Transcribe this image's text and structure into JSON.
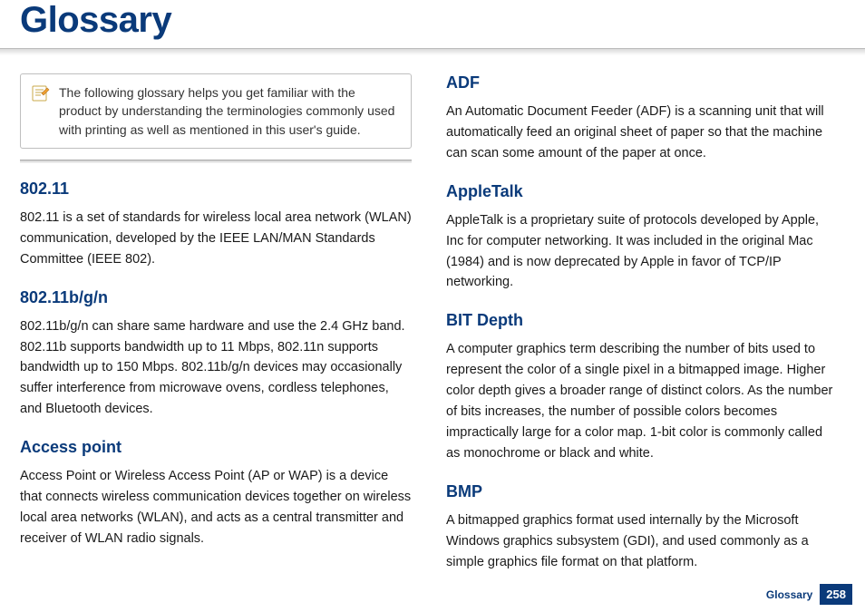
{
  "header": {
    "title": "Glossary"
  },
  "note": {
    "icon": "note-icon",
    "text": "The following glossary helps you get familiar with the product by understanding the terminologies commonly used with printing as well as mentioned in this user's guide."
  },
  "left": [
    {
      "term": "802.11",
      "definition": "802.11 is a set of standards for wireless local area network (WLAN) communication, developed by the IEEE LAN/MAN Standards Committee (IEEE 802)."
    },
    {
      "term": "802.11b/g/n",
      "definition": "802.11b/g/n can share same hardware and use the 2.4 GHz band. 802.11b supports bandwidth up to 11 Mbps, 802.11n supports bandwidth up to 150 Mbps. 802.11b/g/n devices may occasionally suffer interference from microwave ovens, cordless telephones, and Bluetooth devices."
    },
    {
      "term": "Access point",
      "definition": "Access Point or Wireless Access Point (AP or WAP) is a device that connects wireless communication devices together on wireless local area networks (WLAN), and acts as a central transmitter and receiver of WLAN radio signals."
    }
  ],
  "right": [
    {
      "term": "ADF",
      "definition": "An Automatic Document Feeder (ADF) is a scanning unit that will automatically feed an original sheet of paper so that the machine can scan some amount of the paper at once."
    },
    {
      "term": "AppleTalk",
      "definition": "AppleTalk is a proprietary suite of protocols developed by Apple, Inc for computer networking. It was included in the original Mac (1984) and is now deprecated by Apple in favor of TCP/IP networking."
    },
    {
      "term": "BIT Depth",
      "definition": "A computer graphics term describing the number of bits used to represent the color of a single pixel in a bitmapped image. Higher color depth gives a broader range of distinct colors. As the number of bits increases, the number of possible colors becomes impractically large for a color map. 1-bit color is commonly called as monochrome or black and white."
    },
    {
      "term": "BMP",
      "definition": "A bitmapped graphics format used internally by the Microsoft Windows graphics subsystem (GDI), and used commonly as a simple graphics file format on that platform."
    }
  ],
  "footer": {
    "section": "Glossary",
    "page": "258"
  }
}
